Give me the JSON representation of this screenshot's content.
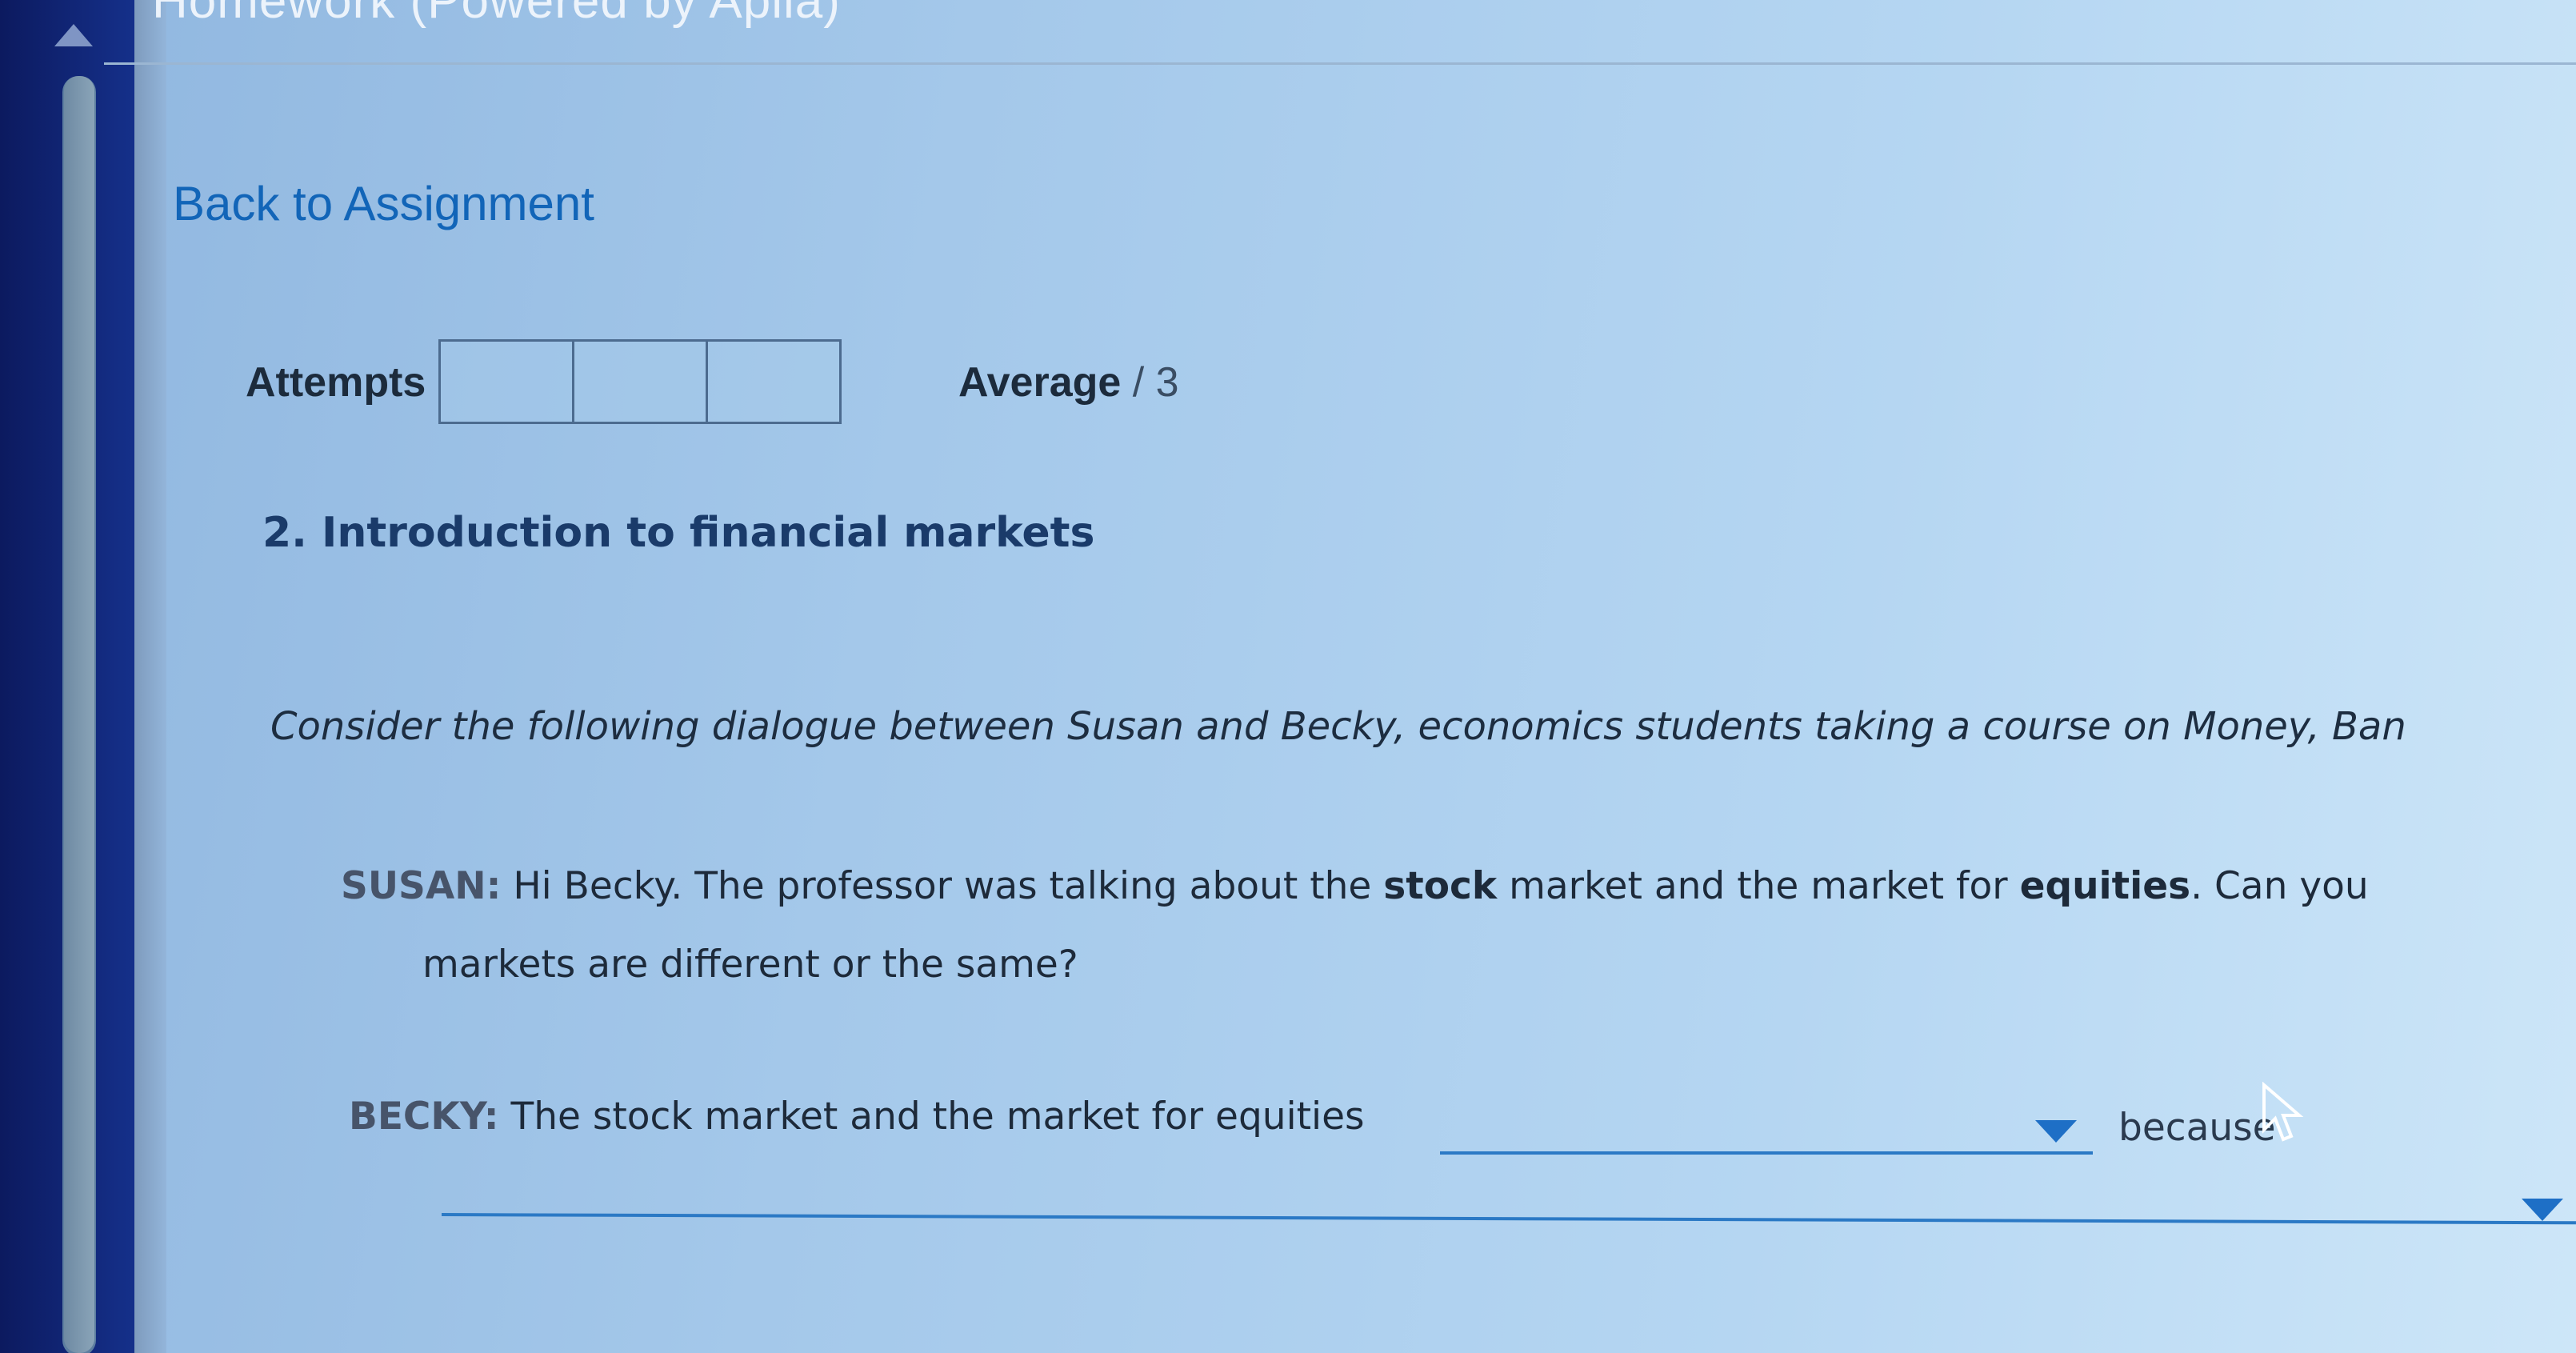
{
  "window": {
    "title": "Homework (Powered by Aplia)"
  },
  "navigation": {
    "back_link": "Back to Assignment"
  },
  "attempts": {
    "label": "Attempts",
    "box_count": 3
  },
  "average": {
    "label": "Average",
    "denominator": "/ 3"
  },
  "question": {
    "number_title": "2. Introduction to financial markets",
    "intro": "Consider the following dialogue between Susan and Becky, economics students taking a course on Money, Ban"
  },
  "dialogue": {
    "susan": {
      "speaker": "SUSAN:",
      "part1": " Hi Becky. The professor was talking about the ",
      "bold1": "stock",
      "part2": " market and the market for ",
      "bold2": "equities",
      "part3": ". Can you",
      "line2": "markets are different or the same?"
    },
    "becky": {
      "speaker": "BECKY:",
      "text": " The stock market and the market for equities",
      "because": "because"
    }
  },
  "dropdowns": [
    {
      "name": "equities-relationship",
      "selected": ""
    },
    {
      "name": "reason",
      "selected": ""
    }
  ],
  "colors": {
    "link": "#1265b8",
    "dropdown_accent": "#1e6fc6",
    "title": "#1a3b6a"
  }
}
